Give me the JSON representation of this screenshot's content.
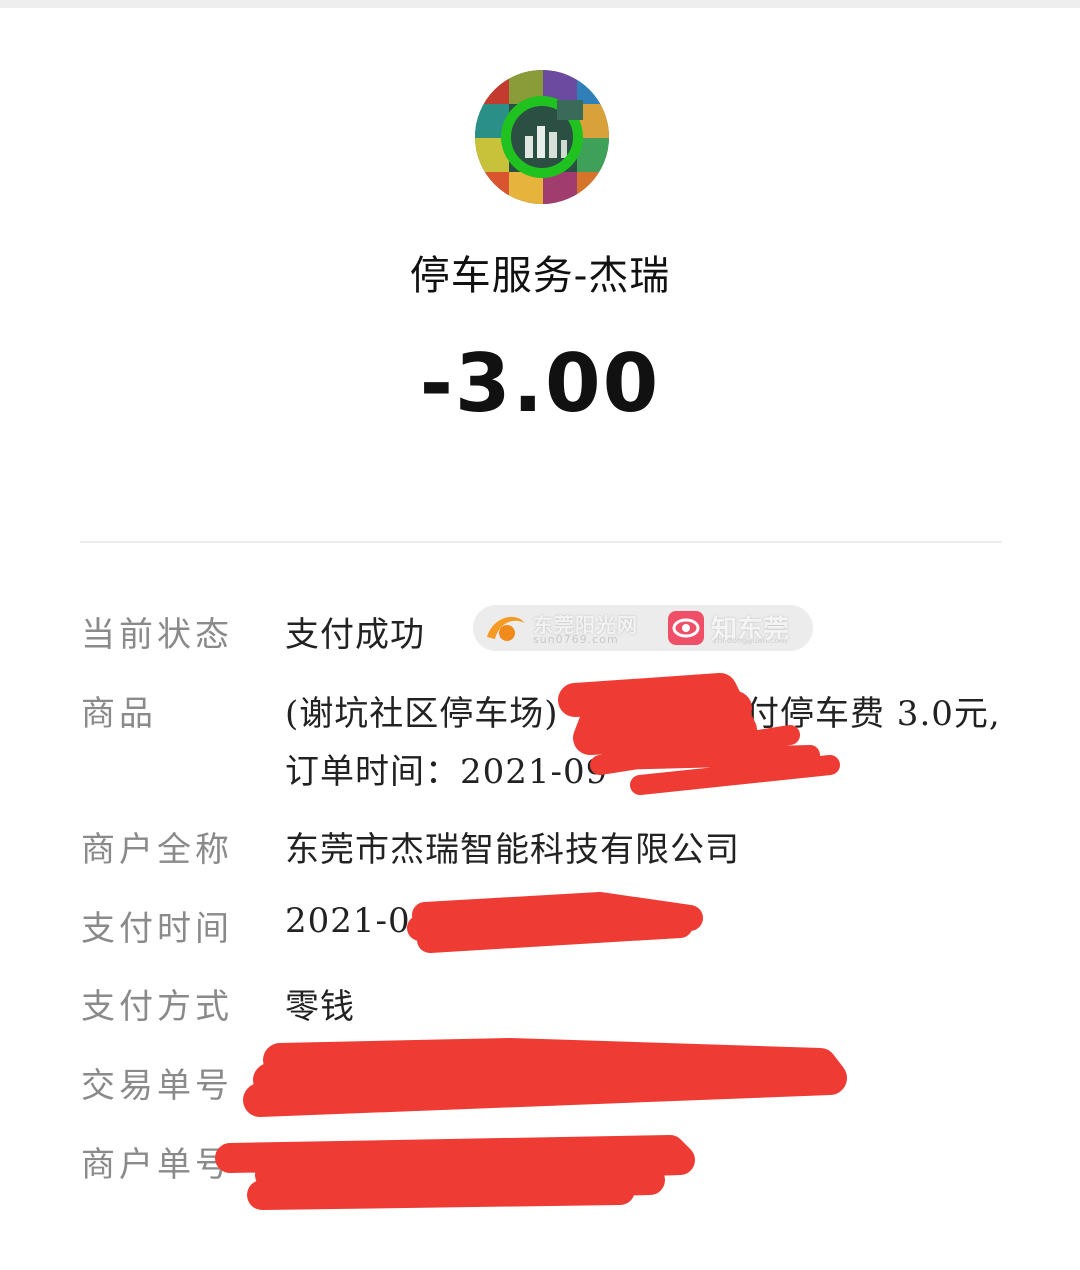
{
  "header": {
    "merchant_title": "停车服务-杰瑞",
    "amount": "-3.00"
  },
  "details": [
    {
      "label": "当前状态",
      "value": "支付成功"
    },
    {
      "label": "商品",
      "value_line1": "(谢坑社区停车场)",
      "value_line1_tail": "付停车费 3.0元,",
      "value_line2": "订单时间：2021-09"
    },
    {
      "label": "商户全称",
      "value": "东莞市杰瑞智能科技有限公司"
    },
    {
      "label": "支付时间",
      "value": "2021-09"
    },
    {
      "label": "支付方式",
      "value": "零钱"
    },
    {
      "label": "交易单号",
      "value": ""
    },
    {
      "label": "商户单号",
      "value": ""
    }
  ],
  "watermark": {
    "brand1": "东莞阳光网",
    "brand1_sub": "sun0769.com",
    "brand2": "知东莞",
    "brand2_sub": "zhi.dongguan.com"
  },
  "colors": {
    "text_primary": "#111111",
    "text_label": "#8a8a8a",
    "redaction": "#ee3b34",
    "avatar_ring": "#1fc21f"
  }
}
